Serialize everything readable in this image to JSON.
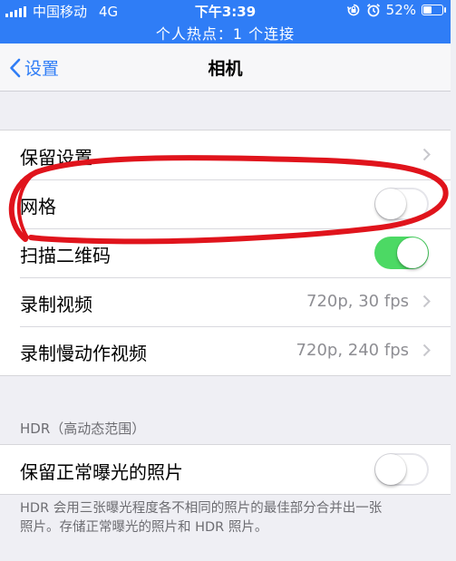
{
  "status_bar": {
    "carrier": "中国移动",
    "network": "4G",
    "time": "下午3:39",
    "battery_percent": "52%",
    "battery_level": 0.52,
    "icons": [
      "signal-icon",
      "orientation-lock-icon",
      "alarm-icon",
      "battery-icon"
    ]
  },
  "hotspot_banner": "个人热点：1 个连接",
  "nav": {
    "back_label": "设置",
    "title": "相机"
  },
  "settings": {
    "preserve": {
      "label": "保留设置"
    },
    "grid": {
      "label": "网格",
      "on": false
    },
    "scan_qr": {
      "label": "扫描二维码",
      "on": true
    },
    "record_video": {
      "label": "录制视频",
      "value": "720p, 30 fps"
    },
    "record_slomo": {
      "label": "录制慢动作视频",
      "value": "720p, 240 fps"
    }
  },
  "hdr": {
    "header": "HDR（高动态范围）",
    "keep_normal": {
      "label": "保留正常曝光的照片",
      "on": false
    },
    "footer_line1": "HDR 会用三张曝光程度各不相同的照片的最佳部分合并出一张",
    "footer_line2": "照片。存储正常曝光的照片和 HDR 照片。"
  },
  "colors": {
    "accent": "#2f7df6",
    "toggle_on": "#4cd964",
    "annotation_red": "#e0141c",
    "background": "#efeff4"
  }
}
